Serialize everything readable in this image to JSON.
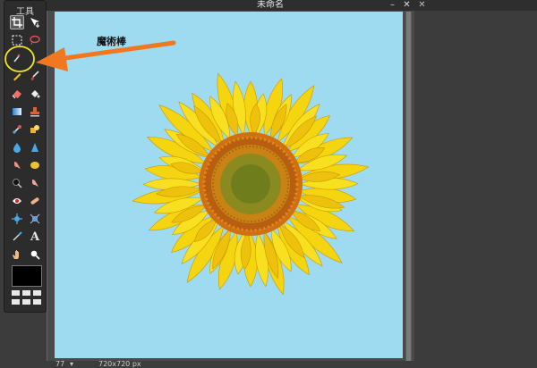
{
  "toolbox": {
    "title": "工具",
    "tools": [
      {
        "name": "crop-icon"
      },
      {
        "name": "move-icon"
      },
      {
        "name": "marquee-icon"
      },
      {
        "name": "lasso-icon"
      },
      {
        "name": "magic-wand-icon"
      },
      {
        "name": "empty-slot"
      },
      {
        "name": "pencil-icon"
      },
      {
        "name": "brush-icon"
      },
      {
        "name": "eraser-icon"
      },
      {
        "name": "bucket-icon"
      },
      {
        "name": "gradient-icon"
      },
      {
        "name": "stamp-icon"
      },
      {
        "name": "color-replace-icon"
      },
      {
        "name": "drawing-icon"
      },
      {
        "name": "blur-icon"
      },
      {
        "name": "sharpen-icon"
      },
      {
        "name": "smudge-icon"
      },
      {
        "name": "sponge-icon"
      },
      {
        "name": "dodge-icon"
      },
      {
        "name": "burn-icon"
      },
      {
        "name": "red-eye-icon"
      },
      {
        "name": "spot-heal-icon"
      },
      {
        "name": "bloat-icon"
      },
      {
        "name": "pinch-icon"
      },
      {
        "name": "color-picker-icon"
      },
      {
        "name": "type-icon"
      },
      {
        "name": "hand-icon"
      },
      {
        "name": "zoom-icon"
      }
    ],
    "type_glyph": "A",
    "foreground_color": "#000000"
  },
  "document": {
    "title": "未命名",
    "minimize_glyph": "–",
    "close_glyph": "✕",
    "canvas_color": "#9edbf0",
    "zoom": "77",
    "size": "720x720 px"
  },
  "annotation": {
    "label": "魔術棒",
    "arrow_color": "#f07820",
    "circle_color": "#f2e61a"
  }
}
